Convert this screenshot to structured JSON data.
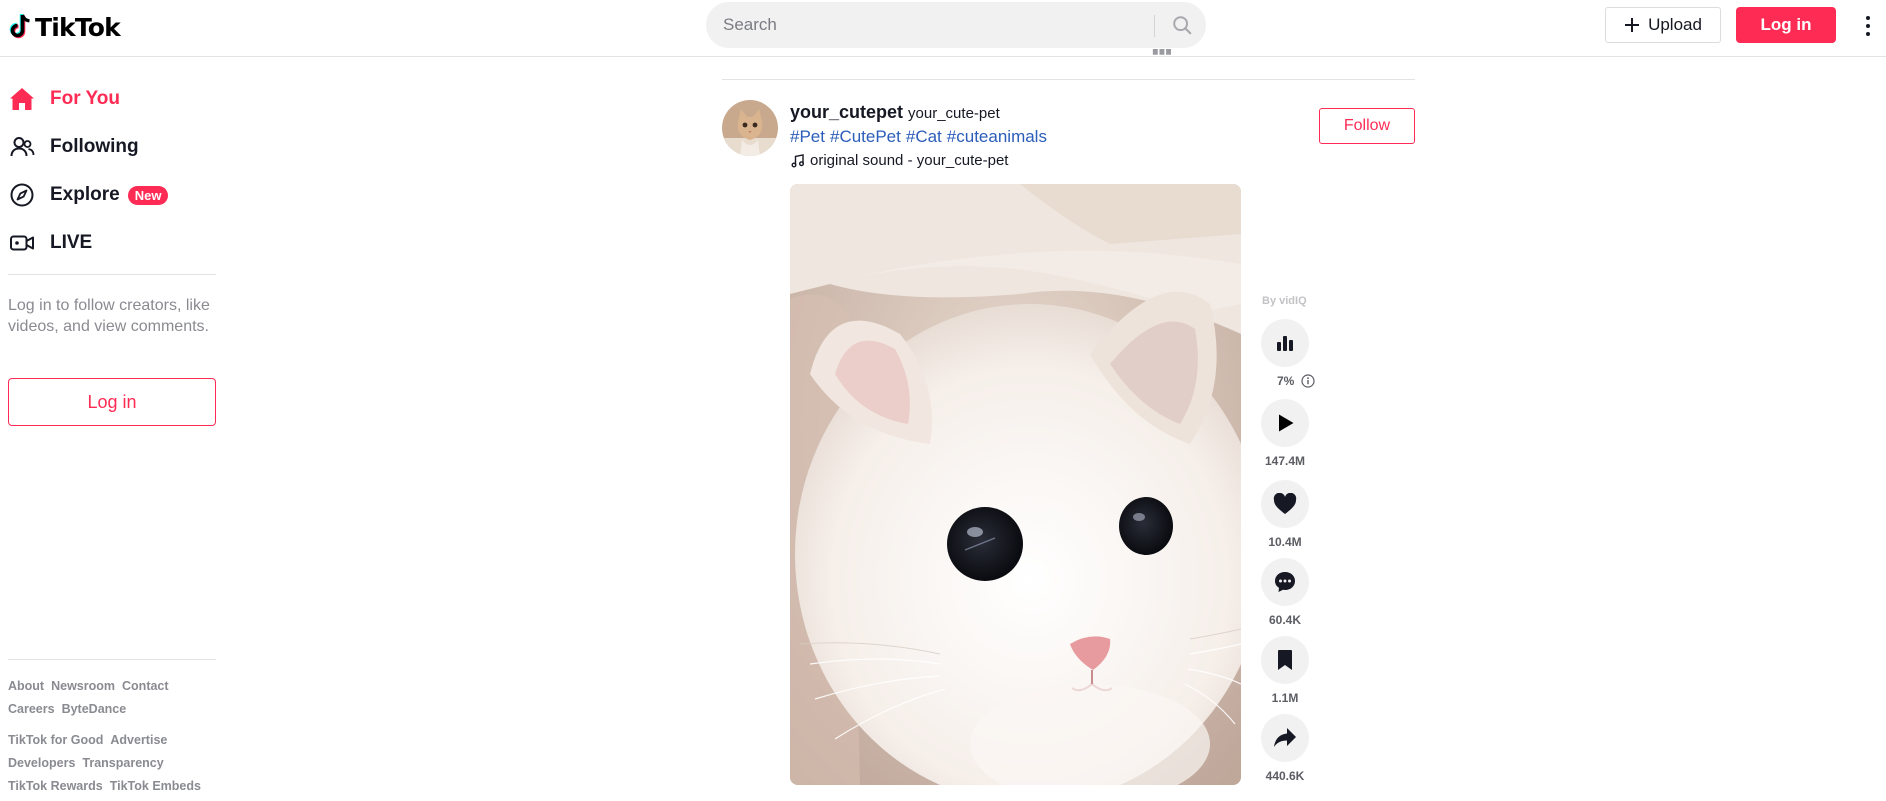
{
  "app": {
    "logo_text": "TikTok"
  },
  "header": {
    "search_placeholder": "Search",
    "upload_label": "Upload",
    "login_label": "Log in"
  },
  "sidebar": {
    "nav": [
      {
        "label": "For You",
        "icon": "home-icon",
        "active": true
      },
      {
        "label": "Following",
        "icon": "people-icon"
      },
      {
        "label": "Explore",
        "icon": "compass-icon",
        "badge": "New"
      },
      {
        "label": "LIVE",
        "icon": "live-camera-icon"
      }
    ],
    "login_prompt": "Log in to follow creators, like videos, and view comments.",
    "login_button": "Log in",
    "footer_row1": [
      "About",
      "Newsroom",
      "Contact",
      "Careers",
      "ByteDance"
    ],
    "footer_row2": [
      "TikTok for Good",
      "Advertise",
      "Developers",
      "Transparency",
      "TikTok Rewards",
      "TikTok Embeds"
    ]
  },
  "post": {
    "author_name": "your_cutepet",
    "author_nickname": "your_cute-pet",
    "hashtags": [
      "#Pet",
      "#CutePet",
      "#Cat",
      "#cuteanimals"
    ],
    "sound": "original sound - your_cute-pet",
    "follow_label": "Follow",
    "vidiq_label": "By vidIQ",
    "engagement_pct": "7%",
    "views": "147.4M",
    "likes": "10.4M",
    "comments": "60.4K",
    "saves": "1.1M",
    "shares": "440.6K"
  },
  "colors": {
    "brand": "#fe2c55",
    "hashtag": "#2b5db9",
    "text": "#161823",
    "muted": "#8a8b91"
  }
}
